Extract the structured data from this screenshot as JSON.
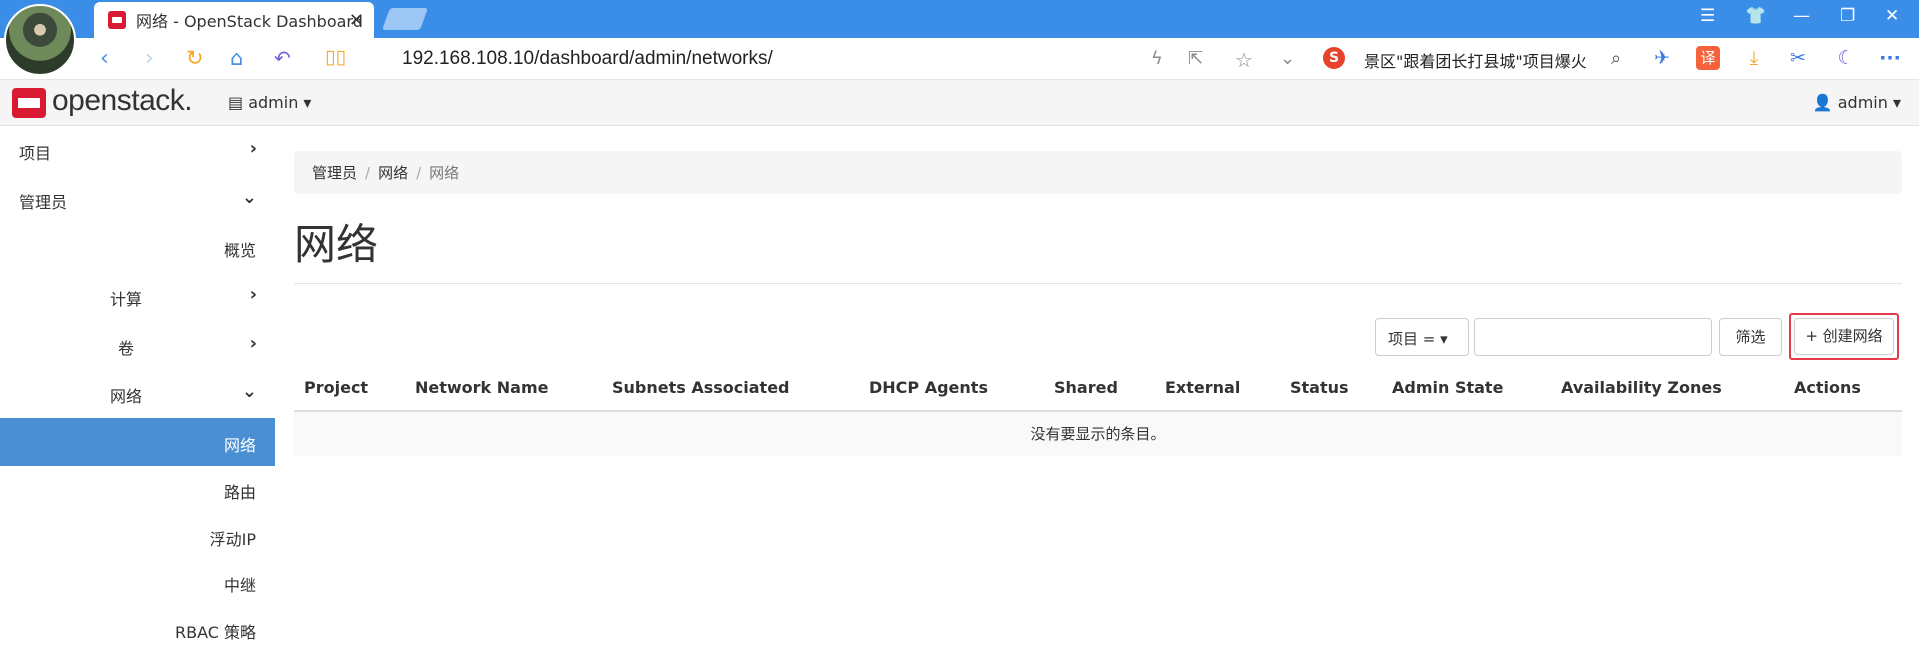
{
  "browser": {
    "tab_title": "网络 - OpenStack Dashboard",
    "tab_close": "✕",
    "url": "192.168.108.10/dashboard/admin/networks/",
    "search_engine": "S",
    "search_text": "景区\"跟着团长打县城\"项目爆火",
    "translate_label": "译"
  },
  "header": {
    "logo": "openstack.",
    "project": "admin ▾",
    "user": "admin ▾"
  },
  "sidebar": {
    "items": [
      {
        "label": "项目",
        "chevron": "›"
      },
      {
        "label": "管理员",
        "chevron": "⌄"
      },
      {
        "label": "概览"
      },
      {
        "label": "计算",
        "chevron": "›"
      },
      {
        "label": "卷",
        "chevron": "›"
      },
      {
        "label": "网络",
        "chevron": "⌄"
      },
      {
        "label": "网络"
      },
      {
        "label": "路由"
      },
      {
        "label": "浮动IP"
      },
      {
        "label": "中继"
      },
      {
        "label": "RBAC 策略"
      }
    ]
  },
  "breadcrumb": [
    "管理员",
    "网络",
    "网络"
  ],
  "page_title": "网络",
  "filter": {
    "field": "项目 = ▾",
    "input_value": "",
    "button": "筛选",
    "create_button": "+ 创建网络"
  },
  "table": {
    "columns": [
      "Project",
      "Network Name",
      "Subnets Associated",
      "DHCP Agents",
      "Shared",
      "External",
      "Status",
      "Admin State",
      "Availability Zones",
      "Actions"
    ],
    "empty_message": "没有要显示的条目。"
  },
  "colors": {
    "titlebar": "#3b8ee8",
    "active_nav": "#4a8fd3",
    "openstack_red": "#da1a32",
    "highlight_border": "#e23a4a"
  }
}
